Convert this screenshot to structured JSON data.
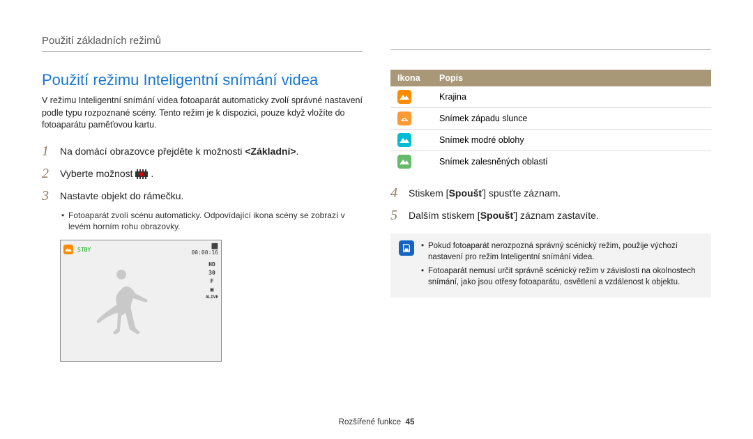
{
  "breadcrumb": "Použití základních režimů",
  "title": "Použití režimu Inteligentní snímání videa",
  "intro": "V režimu Inteligentní snímání videa fotoaparát automaticky zvolí správné nastavení podle typu rozpoznané scény. Tento režim je k dispozici, pouze když vložíte do fotoaparátu paměťovou kartu.",
  "steps": [
    {
      "num": "1",
      "text_before": "Na domácí obrazovce přejděte k možnosti ",
      "bold": "<Základní>",
      "text_after": "."
    },
    {
      "num": "2",
      "text_before": "Vyberte možnost ",
      "bold": "",
      "text_after": "."
    },
    {
      "num": "3",
      "text_before": "Nastavte objekt do rámečku.",
      "bold": "",
      "text_after": ""
    }
  ],
  "step3_sub": "Fotoaparát zvolí scénu automaticky. Odpovídající ikona scény se zobrazí v levém horním rohu obrazovky.",
  "steps_right": [
    {
      "num": "4",
      "text_before": "Stiskem [",
      "bold": "Spoušť",
      "text_after": "] spusťte záznam."
    },
    {
      "num": "5",
      "text_before": "Dalším stiskem [",
      "bold": "Spoušť",
      "text_after": "] záznam zastavíte."
    }
  ],
  "table": {
    "head_icon": "Ikona",
    "head_desc": "Popis",
    "rows": [
      {
        "type": "landscape",
        "desc": "Krajina"
      },
      {
        "type": "sunset",
        "desc": "Snímek západu slunce"
      },
      {
        "type": "bluesky",
        "desc": "Snímek modré oblohy"
      },
      {
        "type": "forest",
        "desc": "Snímek zalesněných oblastí"
      }
    ]
  },
  "notes": [
    "Pokud fotoaparát nerozpozná správný scénický režim, použije výchozí nastavení pro režim Inteligentní snímání videa.",
    "Fotoaparát nemusí určit správně scénický režim v závislosti na okolnostech snímání, jako jsou otřesy fotoaparátu, osvětlení a vzdálenost k objektu."
  ],
  "preview": {
    "stby": "STBY",
    "timer": "00:00:16",
    "sidebar": [
      "HD",
      "30",
      "F",
      "▣",
      "ALIVE"
    ]
  },
  "footer": {
    "label": "Rozšířené funkce",
    "page": "45"
  }
}
